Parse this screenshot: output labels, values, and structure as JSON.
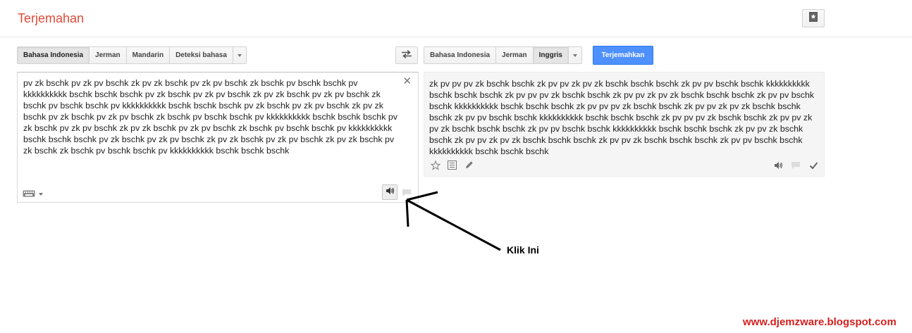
{
  "app": {
    "title": "Terjemahan"
  },
  "source_langs": [
    "Bahasa Indonesia",
    "Jerman",
    "Mandarin",
    "Deteksi bahasa"
  ],
  "target_langs": [
    "Bahasa Indonesia",
    "Jerman",
    "Inggris"
  ],
  "translate_label": "Terjemahkan",
  "source": {
    "text": "pv zk bschk pv zk pv bschk zk pv zk bschk pv zk pv bschk zk bschk pv bschk bschk pv kkkkkkkkkk bschk bschk bschk pv zk bschk pv zk pv bschk zk pv zk bschk pv zk pv bschk zk bschk pv bschk bschk pv kkkkkkkkkk bschk bschk bschk pv zk bschk pv zk pv bschk zk pv zk bschk pv zk bschk pv zk pv bschk zk bschk pv bschk bschk pv kkkkkkkkkk bschk bschk bschk pv zk bschk pv zk pv bschk zk pv zk bschk pv zk pv bschk zk bschk pv bschk bschk pv kkkkkkkkkk bschk bschk bschk pv zk bschk pv zk pv bschk zk pv zk bschk pv zk pv bschk zk pv zk bschk pv zk bschk zk bschk pv bschk bschk pv kkkkkkkkkk bschk bschk bschk"
  },
  "target": {
    "text": "zk pv pv pv zk bschk bschk zk pv pv zk pv zk bschk bschk bschk zk pv pv bschk bschk kkkkkkkkkk bschk bschk bschk zk pv pv pv zk bschk bschk zk pv pv zk pv zk bschk bschk bschk zk pv pv bschk bschk kkkkkkkkkk bschk bschk bschk zk pv pv pv zk bschk bschk zk pv pv zk pv zk bschk bschk bschk zk pv pv bschk bschk kkkkkkkkkk bschk bschk bschk zk pv pv pv zk bschk bschk zk pv pv zk pv zk bschk bschk bschk zk pv pv bschk bschk kkkkkkkkkk bschk bschk bschk zk pv pv zk bschk bschk zk pv pv zk pv zk bschk bschk bschk zk pv pv zk bschk bschk bschk zk pv pv bschk bschk kkkkkkkkkk bschk bschk bschk"
  },
  "annotation": {
    "label": "Klik Ini"
  },
  "watermark": "www.djemzware.blogspot.com",
  "colors": {
    "title": "#dd4b39",
    "primary_button": "#4d90fe",
    "watermark": "#d21f1f"
  },
  "icons": [
    "phrasebook-icon",
    "swap-icon",
    "close-icon",
    "keyboard-icon",
    "speaker-icon",
    "speech-bubble-icon",
    "star-icon",
    "list-icon",
    "pencil-icon",
    "check-icon",
    "arrow-annotation"
  ]
}
